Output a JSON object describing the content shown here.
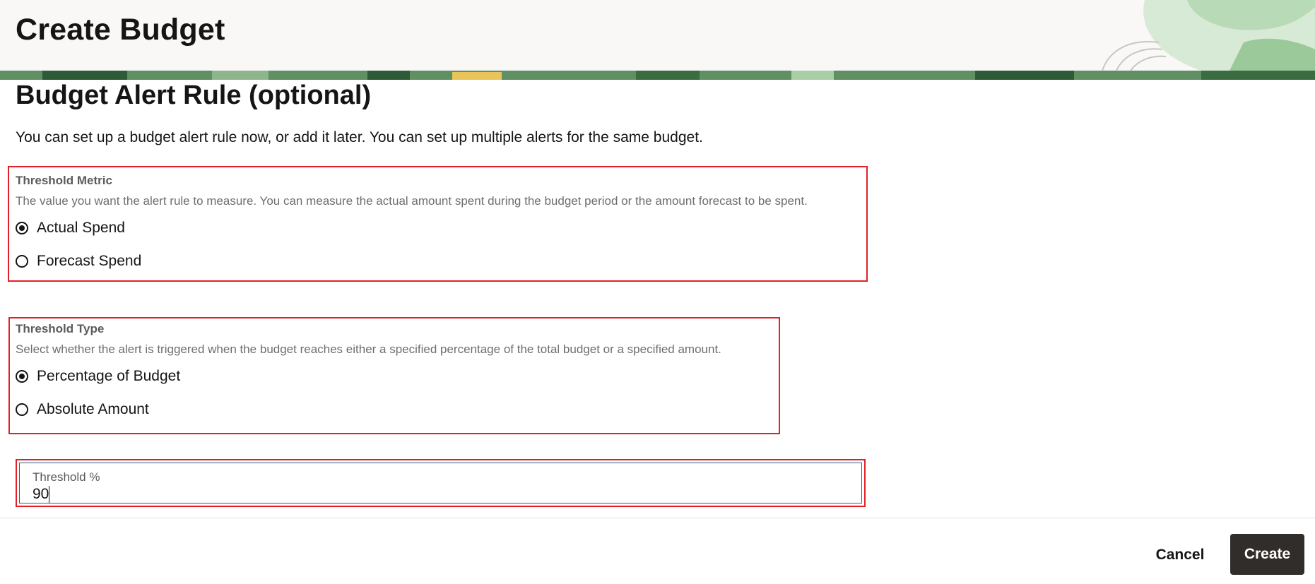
{
  "header": {
    "title": "Create Budget"
  },
  "section": {
    "title": "Budget Alert Rule (optional)",
    "intro": "You can set up a budget alert rule now, or add it later. You can set up multiple alerts for the same budget."
  },
  "threshold_metric": {
    "label": "Threshold Metric",
    "help": "The value you want the alert rule to measure. You can measure the actual amount spent during the budget period or the amount forecast to be spent.",
    "options": [
      {
        "label": "Actual Spend",
        "checked": true
      },
      {
        "label": "Forecast Spend",
        "checked": false
      }
    ]
  },
  "threshold_type": {
    "label": "Threshold Type",
    "help": "Select whether the alert is triggered when the budget reaches either a specified percentage of the total budget or a specified amount.",
    "options": [
      {
        "label": "Percentage of Budget",
        "checked": true
      },
      {
        "label": "Absolute Amount",
        "checked": false
      }
    ]
  },
  "threshold_percent": {
    "label": "Threshold %",
    "value": "90"
  },
  "footer": {
    "cancel_label": "Cancel",
    "create_label": "Create"
  },
  "colors": {
    "highlight_border": "#e21f26",
    "create_button_bg": "#312d2a",
    "header_bg": "#f9f8f6"
  }
}
